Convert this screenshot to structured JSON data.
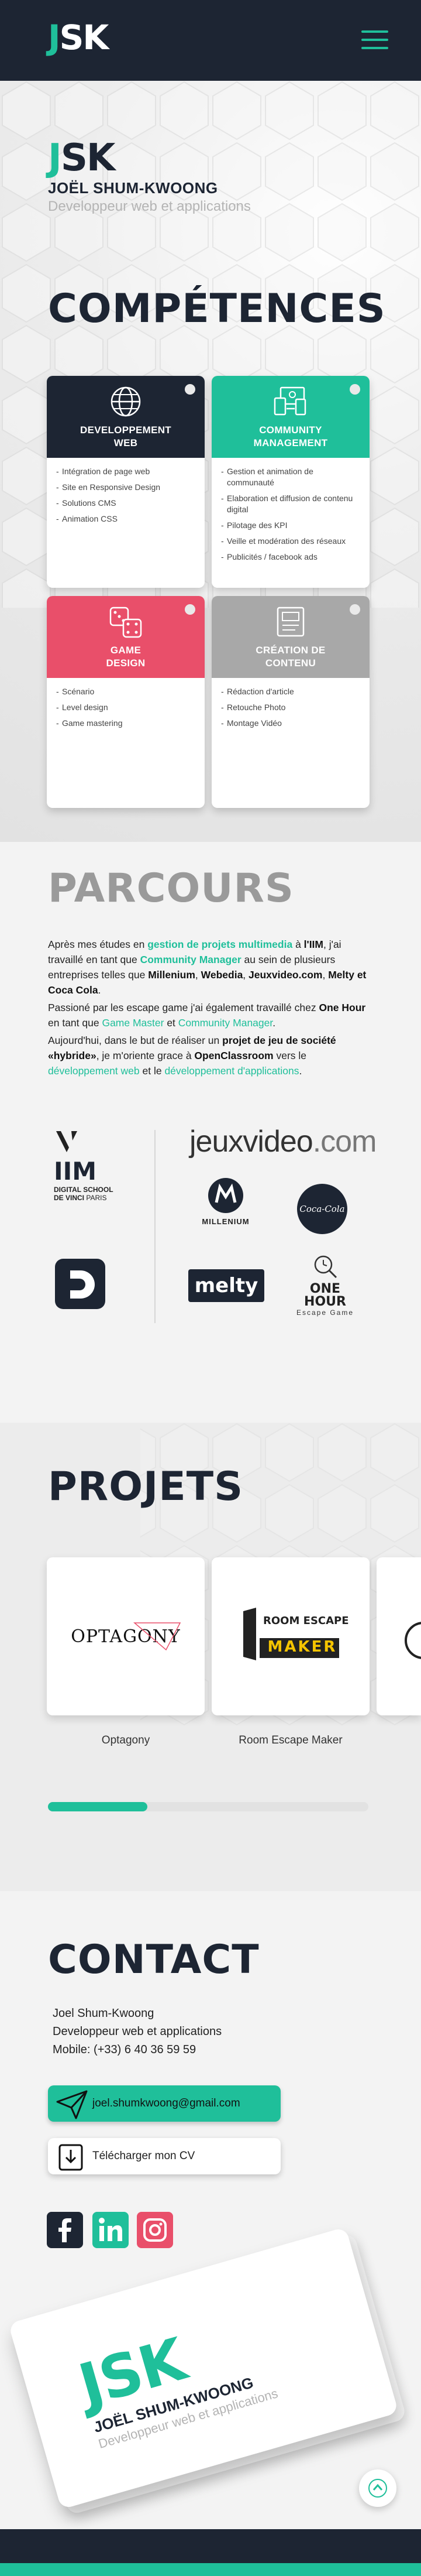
{
  "header": {
    "logo_j": "J",
    "logo_sk": "SK",
    "menu_icon": "hamburger-icon"
  },
  "brand": {
    "logo_j": "J",
    "logo_sk": "SK",
    "name": "JOËL SHUM-KWOONG",
    "subtitle": "Developpeur web et applications"
  },
  "sections": {
    "competences": "COMPÉTENCES",
    "parcours": "PARCOURS",
    "projets": "PROJETS",
    "contact": "CONTACT"
  },
  "competences": [
    {
      "title": [
        "DEVELOPPEMENT",
        "WEB"
      ],
      "icon": "globe-icon",
      "color": "#1d2533",
      "items": [
        "Intégration de page web",
        "Site en Responsive Design",
        "Solutions CMS",
        "Animation CSS"
      ]
    },
    {
      "title": [
        "COMMUNITY",
        "MANAGEMENT"
      ],
      "icon": "devices-icon",
      "color": "#1fbf9a",
      "items": [
        "Gestion et animation de communauté",
        "Elaboration et diffusion de contenu digital",
        "Pilotage des KPI",
        "Veille et modération des réseaux",
        "Publicités / facebook ads"
      ]
    },
    {
      "title": [
        "GAME",
        "DESIGN"
      ],
      "icon": "dice-icon",
      "color": "#e94f6a",
      "items": [
        "Scénario",
        "Level design",
        "Game mastering"
      ]
    },
    {
      "title": [
        "CRÉATION DE",
        "CONTENU"
      ],
      "icon": "article-icon",
      "color": "#a8a8a8",
      "items": [
        "Rédaction d'article",
        "Retouche Photo",
        "Montage Vidéo"
      ]
    }
  ],
  "parcours": {
    "p1": [
      "Après mes études en ",
      "gestion de projets multimedia",
      " à ",
      "l'IIM",
      ", j'ai travaillé en tant que ",
      "Community Manager",
      " au sein de plusieurs entreprises telles que ",
      "Millenium",
      ", ",
      "Webedia",
      ", ",
      "Jeuxvideo.com",
      ", ",
      "Melty et Coca Cola",
      "."
    ],
    "p2": [
      "Passioné par les escape game j'ai également travaillé chez ",
      "One Hour",
      " en tant que ",
      "Game Master",
      " et ",
      "Community Manager",
      "."
    ],
    "p3": [
      "Aujourd'hui, dans le but de réaliser un ",
      "projet de jeu de société «hybride»",
      ", je m'oriente grace à ",
      "OpenClassroom",
      " vers le ",
      "développement web",
      " et le ",
      "développement d'applications",
      "."
    ]
  },
  "logos": {
    "iim": {
      "letter": "IIM",
      "line1": "DIGITAL SCHOOL",
      "line2": "DE VINCI",
      "line2b": "PARIS"
    },
    "jeuxvideo_a": "jeuxvideo",
    "jeuxvideo_b": ".com",
    "millenium": "MILLENIUM",
    "cocacola": "Coca-Cola",
    "melty": "melty",
    "onehour": {
      "main": "ONE HOUR",
      "sub": "Escape Game"
    }
  },
  "projets": [
    {
      "name": "Optagony",
      "logo_text": "OPTAGONY"
    },
    {
      "name": "Room Escape Maker",
      "logo_line1": "ROOM ESCAPE",
      "logo_line2": "MAKER"
    }
  ],
  "carousel_progress": 0.31,
  "contact": {
    "name": "Joel Shum-Kwoong",
    "role": "Developpeur web et applications",
    "mobile": "Mobile: (+33) 6 40 36 59 59",
    "email": "joel.shumkwoong@gmail.com",
    "cv": "Télécharger mon CV"
  },
  "social": [
    {
      "icon": "facebook-icon",
      "label": "f",
      "color": "#1d2533"
    },
    {
      "icon": "linkedin-icon",
      "label": "in",
      "color": "#1fbf9a"
    },
    {
      "icon": "instagram-icon",
      "label": "",
      "color": "#e94f6a"
    }
  ],
  "business_card": {
    "logo_j": "J",
    "logo_sk": "SK",
    "name": "JOËL SHUM-KWOONG",
    "subtitle": "Developpeur web et applications"
  },
  "back_to_top_icon": "arrow-up-icon"
}
